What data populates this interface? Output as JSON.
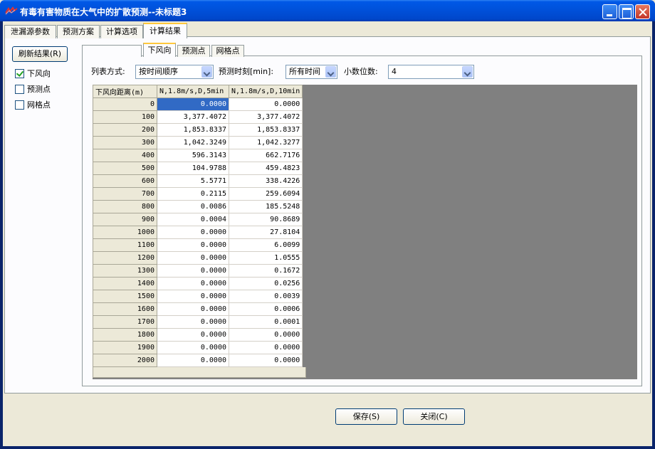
{
  "window": {
    "title": "有毒有害物质在大气中的扩散预测--未标题3",
    "icon": "app-logo-icon"
  },
  "outer_tabs": [
    {
      "label": "泄漏源参数",
      "active": false
    },
    {
      "label": "预测方案",
      "active": false
    },
    {
      "label": "计算选项",
      "active": false
    },
    {
      "label": "计算结果",
      "active": true
    }
  ],
  "sidebar": {
    "refresh_label": "刷新结果(R)",
    "checkboxes": [
      {
        "label": "下风向",
        "checked": true
      },
      {
        "label": "预测点",
        "checked": false
      },
      {
        "label": "网格点",
        "checked": false
      }
    ]
  },
  "inner_tabs": [
    {
      "label": "",
      "active": false
    },
    {
      "label": "下风向",
      "active": true
    },
    {
      "label": "预测点",
      "active": false
    },
    {
      "label": "网格点",
      "active": false
    }
  ],
  "controls": {
    "list_mode_label": "列表方式:",
    "list_mode_value": "按时间顺序",
    "time_label": "预测时刻[min]:",
    "time_value": "所有时间",
    "decimals_label": "小数位数:",
    "decimals_value": "4"
  },
  "table": {
    "headers": [
      "下风向距离(m)",
      "N,1.8m/s,D,5min",
      "N,1.8m/s,D,10min"
    ],
    "rows": [
      [
        "0",
        "0.0000",
        "0.0000"
      ],
      [
        "100",
        "3,377.4072",
        "3,377.4072"
      ],
      [
        "200",
        "1,853.8337",
        "1,853.8337"
      ],
      [
        "300",
        "1,042.3249",
        "1,042.3277"
      ],
      [
        "400",
        "596.3143",
        "662.7176"
      ],
      [
        "500",
        "104.9788",
        "459.4823"
      ],
      [
        "600",
        "5.5771",
        "338.4226"
      ],
      [
        "700",
        "0.2115",
        "259.6094"
      ],
      [
        "800",
        "0.0086",
        "185.5248"
      ],
      [
        "900",
        "0.0004",
        "90.8689"
      ],
      [
        "1000",
        "0.0000",
        "27.8104"
      ],
      [
        "1100",
        "0.0000",
        "6.0099"
      ],
      [
        "1200",
        "0.0000",
        "1.0555"
      ],
      [
        "1300",
        "0.0000",
        "0.1672"
      ],
      [
        "1400",
        "0.0000",
        "0.0256"
      ],
      [
        "1500",
        "0.0000",
        "0.0039"
      ],
      [
        "1600",
        "0.0000",
        "0.0006"
      ],
      [
        "1700",
        "0.0000",
        "0.0001"
      ],
      [
        "1800",
        "0.0000",
        "0.0000"
      ],
      [
        "1900",
        "0.0000",
        "0.0000"
      ],
      [
        "2000",
        "0.0000",
        "0.0000"
      ]
    ]
  },
  "buttons": {
    "save_label": "保存(S)",
    "close_label": "关闭(C)"
  },
  "colors": {
    "titlebar": "#0054E3",
    "selection": "#316AC5",
    "tab_highlight": "#FFC83C",
    "grid_background": "#808080"
  }
}
